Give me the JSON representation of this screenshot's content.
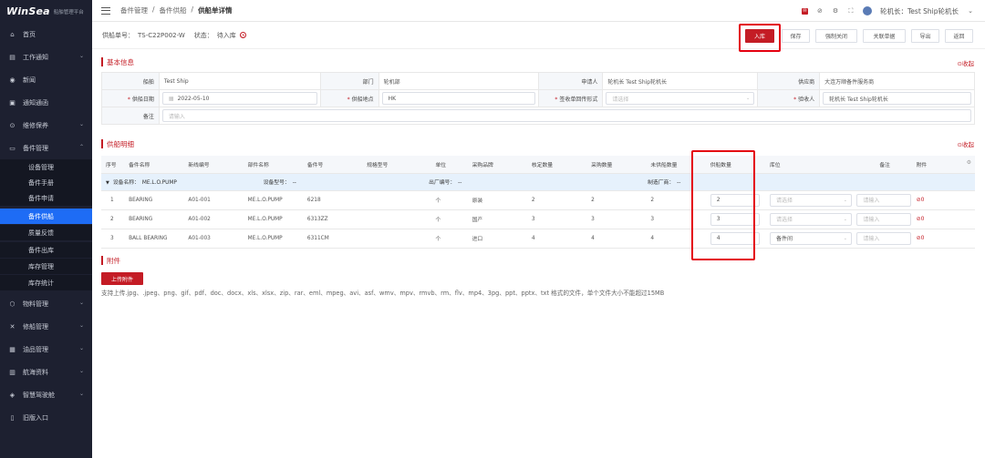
{
  "app": {
    "logo": "WinSea",
    "subtitle": "船舶管理平台"
  },
  "sidebar": {
    "items": [
      {
        "label": "首页",
        "icon": "home-icon"
      },
      {
        "label": "工作通知",
        "icon": "notice-icon"
      },
      {
        "label": "新闻",
        "icon": "news-icon"
      },
      {
        "label": "通知通函",
        "icon": "circular-icon"
      },
      {
        "label": "维修保养",
        "icon": "maintenance-icon"
      },
      {
        "label": "备件管理",
        "icon": "spare-parts-icon"
      },
      {
        "label": "物料管理",
        "icon": "material-icon"
      },
      {
        "label": "修船管理",
        "icon": "repair-icon"
      },
      {
        "label": "油品管理",
        "icon": "oil-icon"
      },
      {
        "label": "航海资料",
        "icon": "navigation-icon"
      },
      {
        "label": "智慧驾驶舱",
        "icon": "dashboard-icon"
      },
      {
        "label": "旧版入口",
        "icon": "legacy-icon"
      }
    ],
    "sub_items": [
      "设备管理",
      "备件手册",
      "备件申请",
      "备件供船",
      "质量反馈",
      "备件出库",
      "库存管理",
      "库存统计"
    ],
    "active_sub": "备件供船"
  },
  "topbar": {
    "breadcrumb": [
      "备件管理",
      "备件供船",
      "供船单详情"
    ],
    "user": "轮机长：Test Ship轮机长"
  },
  "header": {
    "order_label": "供船单号：",
    "order_no": "TS-C22P002-W",
    "status_label": "状态：",
    "status": "待入库"
  },
  "actions": {
    "stock_in": "入库",
    "save": "保存",
    "force_close": "强制关闭",
    "link_doc": "关联单据",
    "export": "导出",
    "back": "返回"
  },
  "basic_info": {
    "title": "基本信息",
    "collapse": "收起",
    "labels": {
      "ship": "船舶",
      "dept": "部门",
      "applicant": "申请人",
      "supplier": "供应商",
      "supply_date": "供船日期",
      "supply_place": "供船地点",
      "receipt_form": "签收单回传形式",
      "receiver": "验收人",
      "remark": "备注"
    },
    "values": {
      "ship": "Test Ship",
      "dept": "轮机部",
      "applicant": "轮机长 Test Ship轮机长",
      "supplier": "大连万顺备件服务商",
      "supply_date": "2022-05-10",
      "supply_place": "HK",
      "receipt_form_placeholder": "请选择",
      "receiver": "轮机长 Test Ship轮机长",
      "remark_placeholder": "请输入"
    }
  },
  "detail": {
    "title": "供船明细",
    "collapse": "收起",
    "columns": [
      "序号",
      "备件名称",
      "新线编号",
      "部件名称",
      "备件号",
      "规格型号",
      "单位",
      "采购品牌",
      "核定数量",
      "采购数量",
      "未供船数量",
      "供船数量",
      "库位",
      "备注",
      "附件"
    ],
    "group": {
      "device_name_label": "设备名称：",
      "device_name": "ME.L.O.PUMP",
      "model_label": "设备型号：",
      "model": "--",
      "factory_no_label": "出厂编号：",
      "factory_no": "--",
      "maker_label": "制造厂商：",
      "maker": "--"
    },
    "rows": [
      {
        "no": "1",
        "name": "BEARING",
        "code": "A01-001",
        "part": "ME.L.O.PUMP",
        "part_no": "6218",
        "spec": "",
        "unit": "个",
        "brand": "原装",
        "approved": "2",
        "purchased": "2",
        "unsupplied": "2",
        "supply_qty": "2",
        "location": "",
        "location_placeholder": "请选择",
        "remark_placeholder": "请输入",
        "attach": "0"
      },
      {
        "no": "2",
        "name": "BEARING",
        "code": "A01-002",
        "part": "ME.L.O.PUMP",
        "part_no": "6313ZZ",
        "spec": "",
        "unit": "个",
        "brand": "国产",
        "approved": "3",
        "purchased": "3",
        "unsupplied": "3",
        "supply_qty": "3",
        "location": "",
        "location_placeholder": "请选择",
        "remark_placeholder": "请输入",
        "attach": "0"
      },
      {
        "no": "3",
        "name": "BALL BEARING",
        "code": "A01-003",
        "part": "ME.L.O.PUMP",
        "part_no": "6311CM",
        "spec": "",
        "unit": "个",
        "brand": "进口",
        "approved": "4",
        "purchased": "4",
        "unsupplied": "4",
        "supply_qty": "4",
        "location": "备件间",
        "location_placeholder": "请选择",
        "remark_placeholder": "请输入",
        "attach": "0"
      }
    ]
  },
  "attachments": {
    "title": "附件",
    "upload": "上传附件",
    "hint": "支持上传.jpg、.jpeg、png、gif、pdf、doc、docx、xls、xlsx、zip、rar、eml、mpeg、avi、asf、wmv、mpv、rmvb、rm、flv、mp4、3pg、ppt、pptx、txt 格式的文件，单个文件大小不能超过15MB"
  },
  "colors": {
    "brand_red": "#c41c25",
    "sidebar_bg": "#1d2030",
    "active_blue": "#1e6cf5",
    "highlight": "#e4000f"
  }
}
